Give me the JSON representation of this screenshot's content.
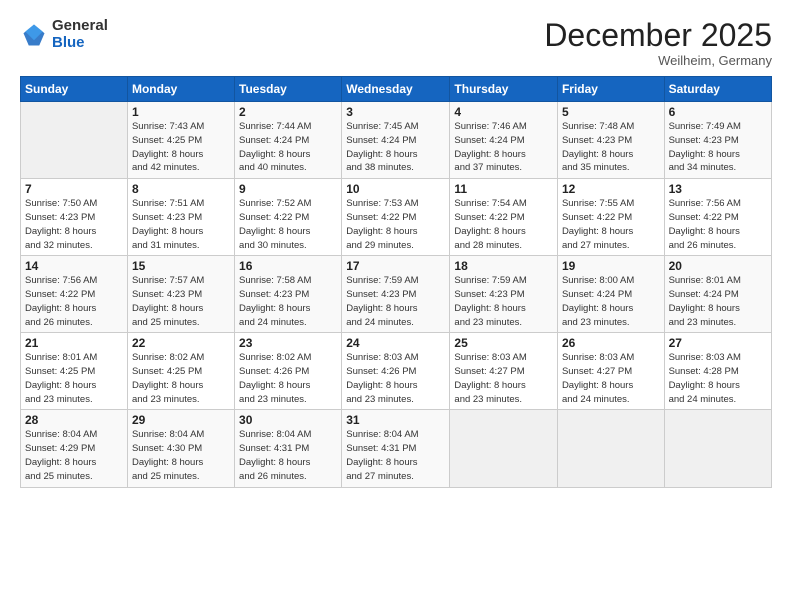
{
  "header": {
    "logo_general": "General",
    "logo_blue": "Blue",
    "month": "December 2025",
    "location": "Weilheim, Germany"
  },
  "weekdays": [
    "Sunday",
    "Monday",
    "Tuesday",
    "Wednesday",
    "Thursday",
    "Friday",
    "Saturday"
  ],
  "weeks": [
    [
      {
        "day": "",
        "info": ""
      },
      {
        "day": "1",
        "info": "Sunrise: 7:43 AM\nSunset: 4:25 PM\nDaylight: 8 hours\nand 42 minutes."
      },
      {
        "day": "2",
        "info": "Sunrise: 7:44 AM\nSunset: 4:24 PM\nDaylight: 8 hours\nand 40 minutes."
      },
      {
        "day": "3",
        "info": "Sunrise: 7:45 AM\nSunset: 4:24 PM\nDaylight: 8 hours\nand 38 minutes."
      },
      {
        "day": "4",
        "info": "Sunrise: 7:46 AM\nSunset: 4:24 PM\nDaylight: 8 hours\nand 37 minutes."
      },
      {
        "day": "5",
        "info": "Sunrise: 7:48 AM\nSunset: 4:23 PM\nDaylight: 8 hours\nand 35 minutes."
      },
      {
        "day": "6",
        "info": "Sunrise: 7:49 AM\nSunset: 4:23 PM\nDaylight: 8 hours\nand 34 minutes."
      }
    ],
    [
      {
        "day": "7",
        "info": "Sunrise: 7:50 AM\nSunset: 4:23 PM\nDaylight: 8 hours\nand 32 minutes."
      },
      {
        "day": "8",
        "info": "Sunrise: 7:51 AM\nSunset: 4:23 PM\nDaylight: 8 hours\nand 31 minutes."
      },
      {
        "day": "9",
        "info": "Sunrise: 7:52 AM\nSunset: 4:22 PM\nDaylight: 8 hours\nand 30 minutes."
      },
      {
        "day": "10",
        "info": "Sunrise: 7:53 AM\nSunset: 4:22 PM\nDaylight: 8 hours\nand 29 minutes."
      },
      {
        "day": "11",
        "info": "Sunrise: 7:54 AM\nSunset: 4:22 PM\nDaylight: 8 hours\nand 28 minutes."
      },
      {
        "day": "12",
        "info": "Sunrise: 7:55 AM\nSunset: 4:22 PM\nDaylight: 8 hours\nand 27 minutes."
      },
      {
        "day": "13",
        "info": "Sunrise: 7:56 AM\nSunset: 4:22 PM\nDaylight: 8 hours\nand 26 minutes."
      }
    ],
    [
      {
        "day": "14",
        "info": "Sunrise: 7:56 AM\nSunset: 4:22 PM\nDaylight: 8 hours\nand 26 minutes."
      },
      {
        "day": "15",
        "info": "Sunrise: 7:57 AM\nSunset: 4:23 PM\nDaylight: 8 hours\nand 25 minutes."
      },
      {
        "day": "16",
        "info": "Sunrise: 7:58 AM\nSunset: 4:23 PM\nDaylight: 8 hours\nand 24 minutes."
      },
      {
        "day": "17",
        "info": "Sunrise: 7:59 AM\nSunset: 4:23 PM\nDaylight: 8 hours\nand 24 minutes."
      },
      {
        "day": "18",
        "info": "Sunrise: 7:59 AM\nSunset: 4:23 PM\nDaylight: 8 hours\nand 23 minutes."
      },
      {
        "day": "19",
        "info": "Sunrise: 8:00 AM\nSunset: 4:24 PM\nDaylight: 8 hours\nand 23 minutes."
      },
      {
        "day": "20",
        "info": "Sunrise: 8:01 AM\nSunset: 4:24 PM\nDaylight: 8 hours\nand 23 minutes."
      }
    ],
    [
      {
        "day": "21",
        "info": "Sunrise: 8:01 AM\nSunset: 4:25 PM\nDaylight: 8 hours\nand 23 minutes."
      },
      {
        "day": "22",
        "info": "Sunrise: 8:02 AM\nSunset: 4:25 PM\nDaylight: 8 hours\nand 23 minutes."
      },
      {
        "day": "23",
        "info": "Sunrise: 8:02 AM\nSunset: 4:26 PM\nDaylight: 8 hours\nand 23 minutes."
      },
      {
        "day": "24",
        "info": "Sunrise: 8:03 AM\nSunset: 4:26 PM\nDaylight: 8 hours\nand 23 minutes."
      },
      {
        "day": "25",
        "info": "Sunrise: 8:03 AM\nSunset: 4:27 PM\nDaylight: 8 hours\nand 23 minutes."
      },
      {
        "day": "26",
        "info": "Sunrise: 8:03 AM\nSunset: 4:27 PM\nDaylight: 8 hours\nand 24 minutes."
      },
      {
        "day": "27",
        "info": "Sunrise: 8:03 AM\nSunset: 4:28 PM\nDaylight: 8 hours\nand 24 minutes."
      }
    ],
    [
      {
        "day": "28",
        "info": "Sunrise: 8:04 AM\nSunset: 4:29 PM\nDaylight: 8 hours\nand 25 minutes."
      },
      {
        "day": "29",
        "info": "Sunrise: 8:04 AM\nSunset: 4:30 PM\nDaylight: 8 hours\nand 25 minutes."
      },
      {
        "day": "30",
        "info": "Sunrise: 8:04 AM\nSunset: 4:31 PM\nDaylight: 8 hours\nand 26 minutes."
      },
      {
        "day": "31",
        "info": "Sunrise: 8:04 AM\nSunset: 4:31 PM\nDaylight: 8 hours\nand 27 minutes."
      },
      {
        "day": "",
        "info": ""
      },
      {
        "day": "",
        "info": ""
      },
      {
        "day": "",
        "info": ""
      }
    ]
  ]
}
